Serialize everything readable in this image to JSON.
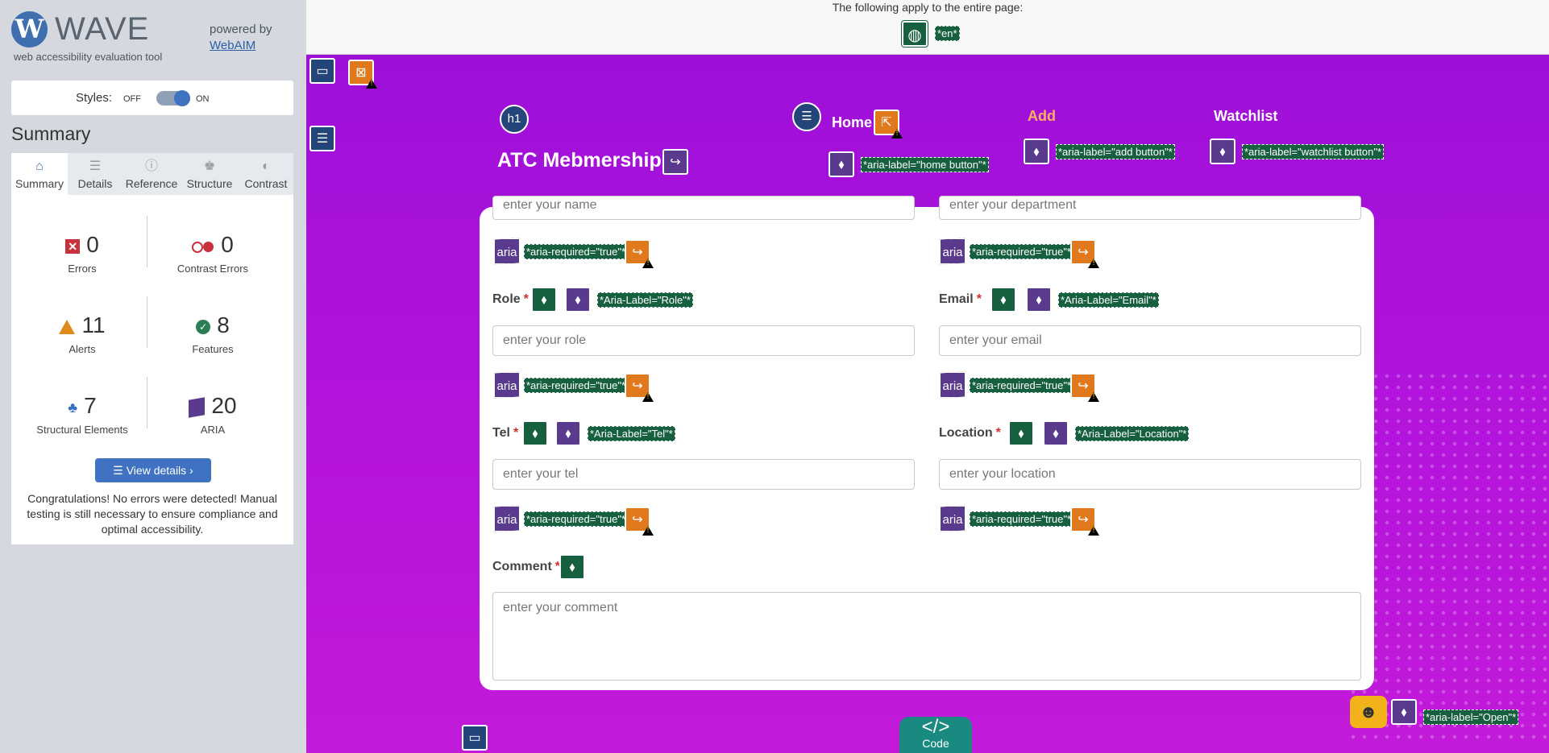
{
  "wave": {
    "logo_letter": "W",
    "name": "WAVE",
    "tagline": "web accessibility evaluation tool",
    "powered_by": "powered by",
    "webaim": "WebAIM",
    "styles_label": "Styles:",
    "styles_off": "OFF",
    "styles_on": "ON",
    "summary_heading": "Summary",
    "tabs": [
      {
        "label": "Summary",
        "icon": "home-icon",
        "glyph": "⌂"
      },
      {
        "label": "Details",
        "icon": "list-icon",
        "glyph": "☰"
      },
      {
        "label": "Reference",
        "icon": "info-icon",
        "glyph": "ⓘ"
      },
      {
        "label": "Structure",
        "icon": "structure-icon",
        "glyph": "♚"
      },
      {
        "label": "Contrast",
        "icon": "contrast-icon",
        "glyph": "◐"
      }
    ],
    "stats": {
      "errors": {
        "count": "0",
        "label": "Errors"
      },
      "contrast": {
        "count": "0",
        "label": "Contrast Errors"
      },
      "alerts": {
        "count": "11",
        "label": "Alerts"
      },
      "features": {
        "count": "8",
        "label": "Features"
      },
      "structure": {
        "count": "7",
        "label": "Structural Elements"
      },
      "aria": {
        "count": "20",
        "label": "ARIA"
      }
    },
    "view_details": "View details ›",
    "congrats": "Congratulations! No errors were detected! Manual testing is still necessary to ensure compliance and optimal accessibility."
  },
  "page": {
    "notice": "The following apply to the entire page:",
    "lang": "*en*",
    "h1_badge": "h1",
    "title": "ATC Mebmership",
    "nav": [
      {
        "label": "Home",
        "aria": "*aria-label=\"home button\"*"
      },
      {
        "label": "Add",
        "aria": "*aria-label=\"add button\"*"
      },
      {
        "label": "Watchlist",
        "aria": "*aria-label=\"watchlist button\"*"
      }
    ],
    "aria_badge": "aria",
    "aria_required": "*aria-required=\"true\"*",
    "fields": {
      "name_placeholder": "enter your name",
      "department_placeholder": "enter your department",
      "role_label": "Role",
      "role_aria": "*Aria-Label=\"Role\"*",
      "role_placeholder": "enter your role",
      "email_label": "Email",
      "email_aria": "*Aria-Label=\"Email\"*",
      "email_placeholder": "enter your email",
      "tel_label": "Tel",
      "tel_aria": "*Aria-Label=\"Tel\"*",
      "tel_placeholder": "enter your tel",
      "location_label": "Location",
      "location_aria": "*Aria-Label=\"Location\"*",
      "location_placeholder": "enter your location",
      "comment_label": "Comment",
      "comment_placeholder": "enter your comment",
      "required_mark": "*"
    },
    "code_button": "Code",
    "code_glyph": "</>",
    "chat_aria": "*aria-label=\"Open\"*"
  },
  "colors": {
    "wave_blue": "#3f6fae",
    "aria_purple": "#5a3a8c",
    "feature_green": "#17603f",
    "alert_orange": "#e0781c",
    "page_purple": "#9a0fd8"
  }
}
